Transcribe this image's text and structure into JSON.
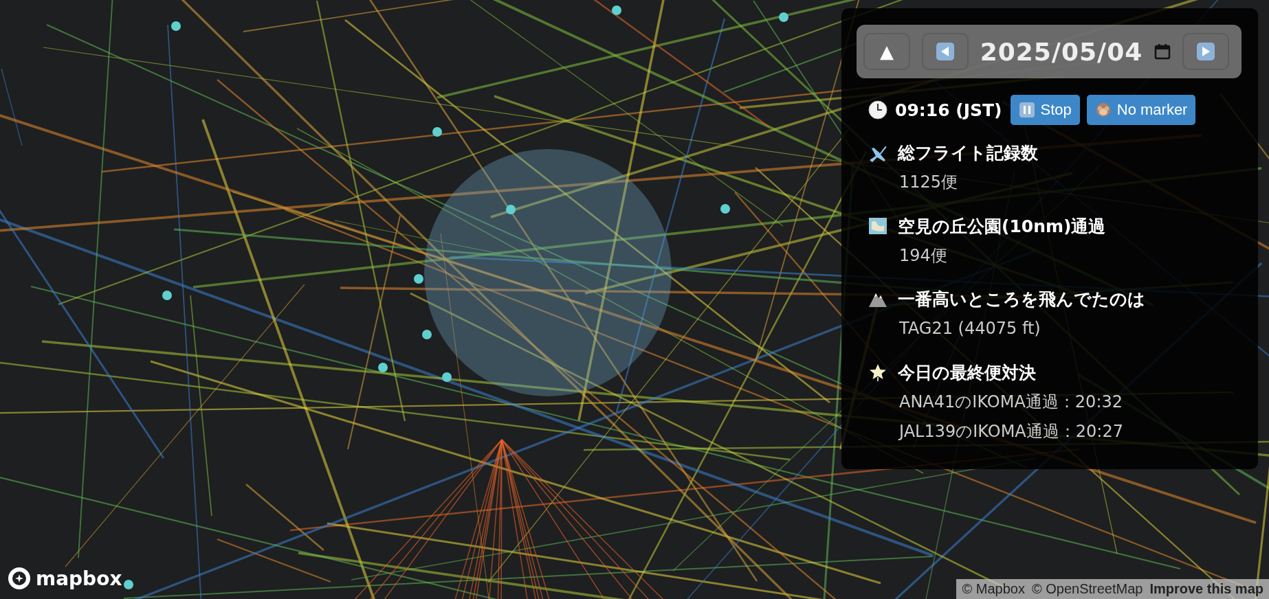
{
  "date_bar": {
    "up": "▲",
    "date": "2025/05/04"
  },
  "clock": {
    "time": "09:16 (JST)",
    "buttons": [
      "Stop",
      "No marker"
    ]
  },
  "stats": [
    {
      "title": "総フライト記録数",
      "lines": [
        "1125便"
      ]
    },
    {
      "title": "空見の丘公園(10nm)通過",
      "lines": [
        "194便"
      ]
    },
    {
      "title": "一番高いところを飛んでたのは",
      "lines": [
        "TAG21 (44075 ft)"
      ]
    },
    {
      "title": "今日の最終便対決",
      "lines": [
        "ANA41のIKOMA通過：20:32",
        "JAL139のIKOMA通過：20:27"
      ]
    }
  ],
  "logo": "mapbox",
  "attribution": [
    "© Mapbox",
    "© OpenStreetMap",
    "Improve this map"
  ]
}
